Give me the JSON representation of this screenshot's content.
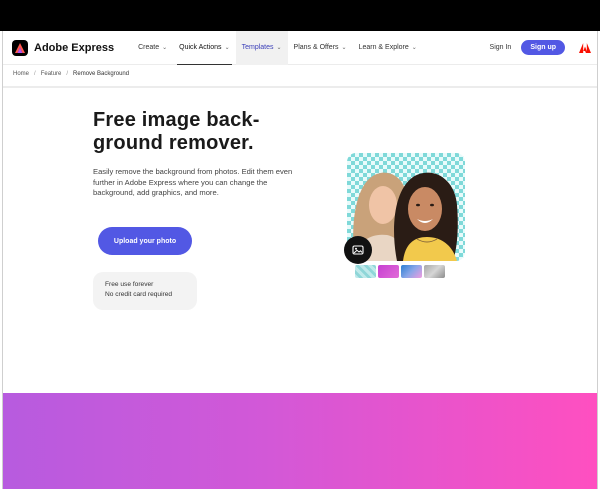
{
  "brand": {
    "name": "Adobe Express"
  },
  "nav": {
    "items": [
      {
        "label": "Create",
        "has_menu": true
      },
      {
        "label": "Quick Actions",
        "has_menu": true
      },
      {
        "label": "Templates",
        "has_menu": true
      },
      {
        "label": "Plans & Offers",
        "has_menu": true
      },
      {
        "label": "Learn & Explore",
        "has_menu": true
      }
    ],
    "chevron": "⌄",
    "sign_in": "Sign In",
    "sign_up": "Sign up",
    "adobe_icon": "adobe-logo-icon"
  },
  "breadcrumb": {
    "items": [
      "Home",
      "Feature",
      "Remove Background"
    ],
    "separator": "/"
  },
  "hero": {
    "title": "Free image back-ground remover.",
    "title_line1": "Free image back-",
    "title_line2": "ground remover.",
    "subtitle": "Easily remove the background from photos. Edit them even further in Adobe Express where you can change the background, add graphics, and more.",
    "cta": "Upload your photo",
    "info_line1": "Free use forever",
    "info_line2": "No credit card required"
  },
  "colors": {
    "accent": "#5258e4",
    "gradient_start": "#b75bdf",
    "gradient_end": "#ff4fc0",
    "checker": "#7fd9d9"
  }
}
